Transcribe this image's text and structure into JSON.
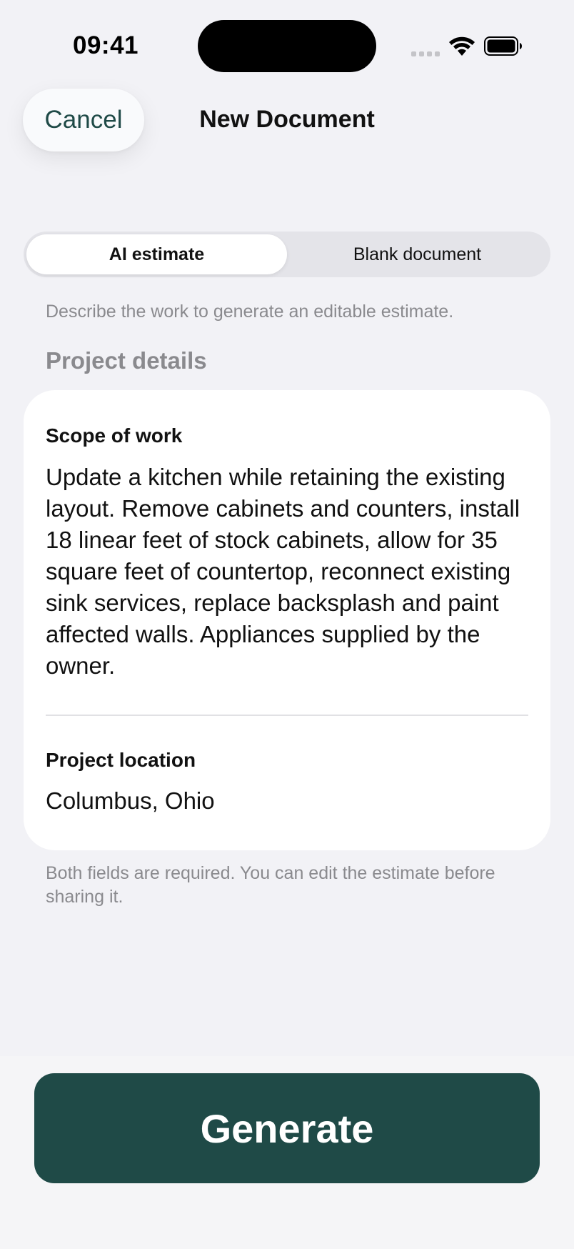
{
  "status_bar": {
    "time": "09:41",
    "icons": [
      "signal-icon",
      "wifi-icon",
      "battery-icon"
    ]
  },
  "nav": {
    "cancel_label": "Cancel",
    "title": "New Document"
  },
  "segmented_control": {
    "options": [
      {
        "label": "AI estimate",
        "selected": true
      },
      {
        "label": "Blank document",
        "selected": false
      }
    ]
  },
  "helper_text": "Describe the work to generate an editable estimate.",
  "section_header": "Project details",
  "form": {
    "scope_label": "Scope of work",
    "scope_value": "Update a kitchen while retaining the existing layout. Remove cabinets and counters, install 18 linear feet of stock cabinets, allow for 35 square feet of countertop, reconnect existing sink services, replace backsplash and paint affected walls. Appliances supplied by the owner.",
    "location_label": "Project location",
    "location_value": "Columbus, Ohio"
  },
  "footer_note": "Both fields are required. You can edit the estimate before sharing it.",
  "primary_action": {
    "label": "Generate"
  },
  "colors": {
    "accent": "#1f4a47",
    "background": "#f2f2f6",
    "card": "#ffffff",
    "secondary_text": "#8a8a8e",
    "segment_track": "#e4e4e9"
  }
}
